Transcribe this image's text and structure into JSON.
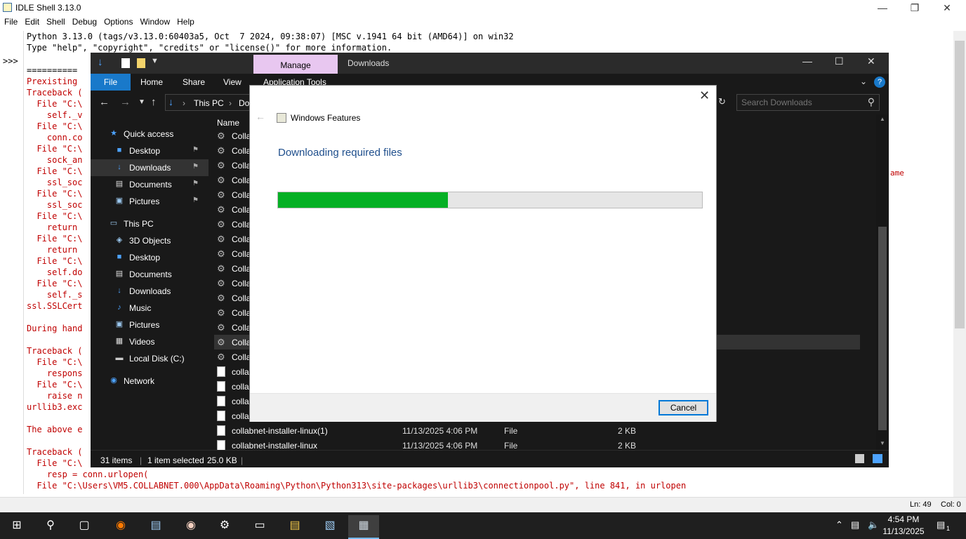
{
  "idle": {
    "title": "IDLE Shell 3.13.0",
    "menu": [
      "File",
      "Edit",
      "Shell",
      "Debug",
      "Options",
      "Window",
      "Help"
    ],
    "prompt": ">>>",
    "lines": [
      {
        "t": "Python 3.13.0 (tags/v3.13.0:60403a5, Oct  7 2024, 09:38:07) [MSC v.1941 64 bit (AMD64)] on win32",
        "c": "blk"
      },
      {
        "t": "Type \"help\", \"copyright\", \"credits\" or \"license()\" for more information.",
        "c": "blk"
      },
      {
        "t": "",
        "c": "blk"
      },
      {
        "t": "==========",
        "c": "blk"
      },
      {
        "t": "Prexisting",
        "c": "red"
      },
      {
        "t": "Traceback (",
        "c": "red"
      },
      {
        "t": "  File \"C:\\",
        "c": "red"
      },
      {
        "t": "    self._v",
        "c": "red"
      },
      {
        "t": "  File \"C:\\",
        "c": "red"
      },
      {
        "t": "    conn.co",
        "c": "red"
      },
      {
        "t": "  File \"C:\\",
        "c": "red"
      },
      {
        "t": "    sock_an",
        "c": "red"
      },
      {
        "t": "  File \"C:\\",
        "c": "red"
      },
      {
        "t": "    ssl_soc",
        "c": "red"
      },
      {
        "t": "  File \"C:\\",
        "c": "red"
      },
      {
        "t": "    ssl_soc",
        "c": "red"
      },
      {
        "t": "  File \"C:\\",
        "c": "red"
      },
      {
        "t": "    return ",
        "c": "red"
      },
      {
        "t": "  File \"C:\\",
        "c": "red"
      },
      {
        "t": "    return ",
        "c": "red"
      },
      {
        "t": "  File \"C:\\",
        "c": "red"
      },
      {
        "t": "    self.do",
        "c": "red"
      },
      {
        "t": "  File \"C:\\",
        "c": "red"
      },
      {
        "t": "    self._s",
        "c": "red"
      },
      {
        "t": "ssl.SSLCert",
        "c": "red"
      },
      {
        "t": "",
        "c": "red"
      },
      {
        "t": "During hand",
        "c": "red"
      },
      {
        "t": "",
        "c": "red"
      },
      {
        "t": "Traceback (",
        "c": "red"
      },
      {
        "t": "  File \"C:\\",
        "c": "red"
      },
      {
        "t": "    respons",
        "c": "red"
      },
      {
        "t": "  File \"C:\\",
        "c": "red"
      },
      {
        "t": "    raise n",
        "c": "red"
      },
      {
        "t": "urllib3.exc",
        "c": "red"
      },
      {
        "t": "",
        "c": "red"
      },
      {
        "t": "The above e",
        "c": "red"
      },
      {
        "t": "",
        "c": "red"
      },
      {
        "t": "Traceback (",
        "c": "red"
      },
      {
        "t": "  File \"C:\\",
        "c": "red"
      },
      {
        "t": "    resp = conn.urlopen(",
        "c": "red"
      },
      {
        "t": "  File \"C:\\Users\\VM5.COLLABNET.000\\AppData\\Roaming\\Python\\Python313\\site-packages\\urllib3\\connectionpool.py\", line 841, in urlopen",
        "c": "red"
      }
    ],
    "side_fragment": "ame",
    "status": {
      "line": "Ln: 49",
      "col": "Col: 0"
    }
  },
  "explorer": {
    "ribbon_context_tab": "Manage",
    "window_title": "Downloads",
    "tabs": [
      "File",
      "Home",
      "Share",
      "View",
      "Application Tools"
    ],
    "address": {
      "root": "This PC",
      "current": "Do"
    },
    "search_placeholder": "Search Downloads",
    "nav": {
      "quick_access": "Quick access",
      "quick_items": [
        "Desktop",
        "Downloads",
        "Documents",
        "Pictures"
      ],
      "this_pc": "This PC",
      "pc_items": [
        "3D Objects",
        "Desktop",
        "Documents",
        "Downloads",
        "Music",
        "Pictures",
        "Videos",
        "Local Disk (C:)"
      ],
      "network": "Network"
    },
    "column_name": "Name",
    "files": [
      {
        "name": "Colla",
        "date": "",
        "type": "",
        "size": ""
      },
      {
        "name": "Colla",
        "date": "",
        "type": "",
        "size": ""
      },
      {
        "name": "Colla",
        "date": "",
        "type": "",
        "size": ""
      },
      {
        "name": "Colla",
        "date": "",
        "type": "",
        "size": ""
      },
      {
        "name": "Colla",
        "date": "",
        "type": "",
        "size": ""
      },
      {
        "name": "Colla",
        "date": "",
        "type": "",
        "size": ""
      },
      {
        "name": "Colla",
        "date": "",
        "type": "",
        "size": ""
      },
      {
        "name": "Colla",
        "date": "",
        "type": "",
        "size": ""
      },
      {
        "name": "Colla",
        "date": "",
        "type": "",
        "size": ""
      },
      {
        "name": "Colla",
        "date": "",
        "type": "",
        "size": ""
      },
      {
        "name": "Colla",
        "date": "",
        "type": "",
        "size": ""
      },
      {
        "name": "Colla",
        "date": "",
        "type": "",
        "size": ""
      },
      {
        "name": "Colla",
        "date": "",
        "type": "",
        "size": ""
      },
      {
        "name": "Colla",
        "date": "",
        "type": "",
        "size": ""
      },
      {
        "name": "Colla",
        "date": "",
        "type": "",
        "size": ""
      },
      {
        "name": "Colla",
        "date": "",
        "type": "",
        "size": ""
      },
      {
        "name": "colla",
        "date": "",
        "type": "",
        "size": ""
      },
      {
        "name": "colla",
        "date": "",
        "type": "",
        "size": ""
      },
      {
        "name": "colla",
        "date": "",
        "type": "",
        "size": ""
      },
      {
        "name": "colla",
        "date": "",
        "type": "",
        "size": ""
      },
      {
        "name": "collabnet-installer-linux(1)",
        "date": "11/13/2025 4:06 PM",
        "type": "File",
        "size": "2 KB"
      },
      {
        "name": "collabnet-installer-linux",
        "date": "11/13/2025 4:06 PM",
        "type": "File",
        "size": "2 KB"
      }
    ],
    "status": {
      "items": "31 items",
      "selected": "1 item selected",
      "size": "25.0 KB"
    }
  },
  "dialog": {
    "title": "Windows Features",
    "heading": "Downloading required files",
    "progress_fraction": 0.4,
    "progress_color": "#06b025",
    "cancel": "Cancel"
  },
  "taskbar": {
    "time": "4:54 PM",
    "date": "11/13/2025",
    "notification_count": "1"
  }
}
